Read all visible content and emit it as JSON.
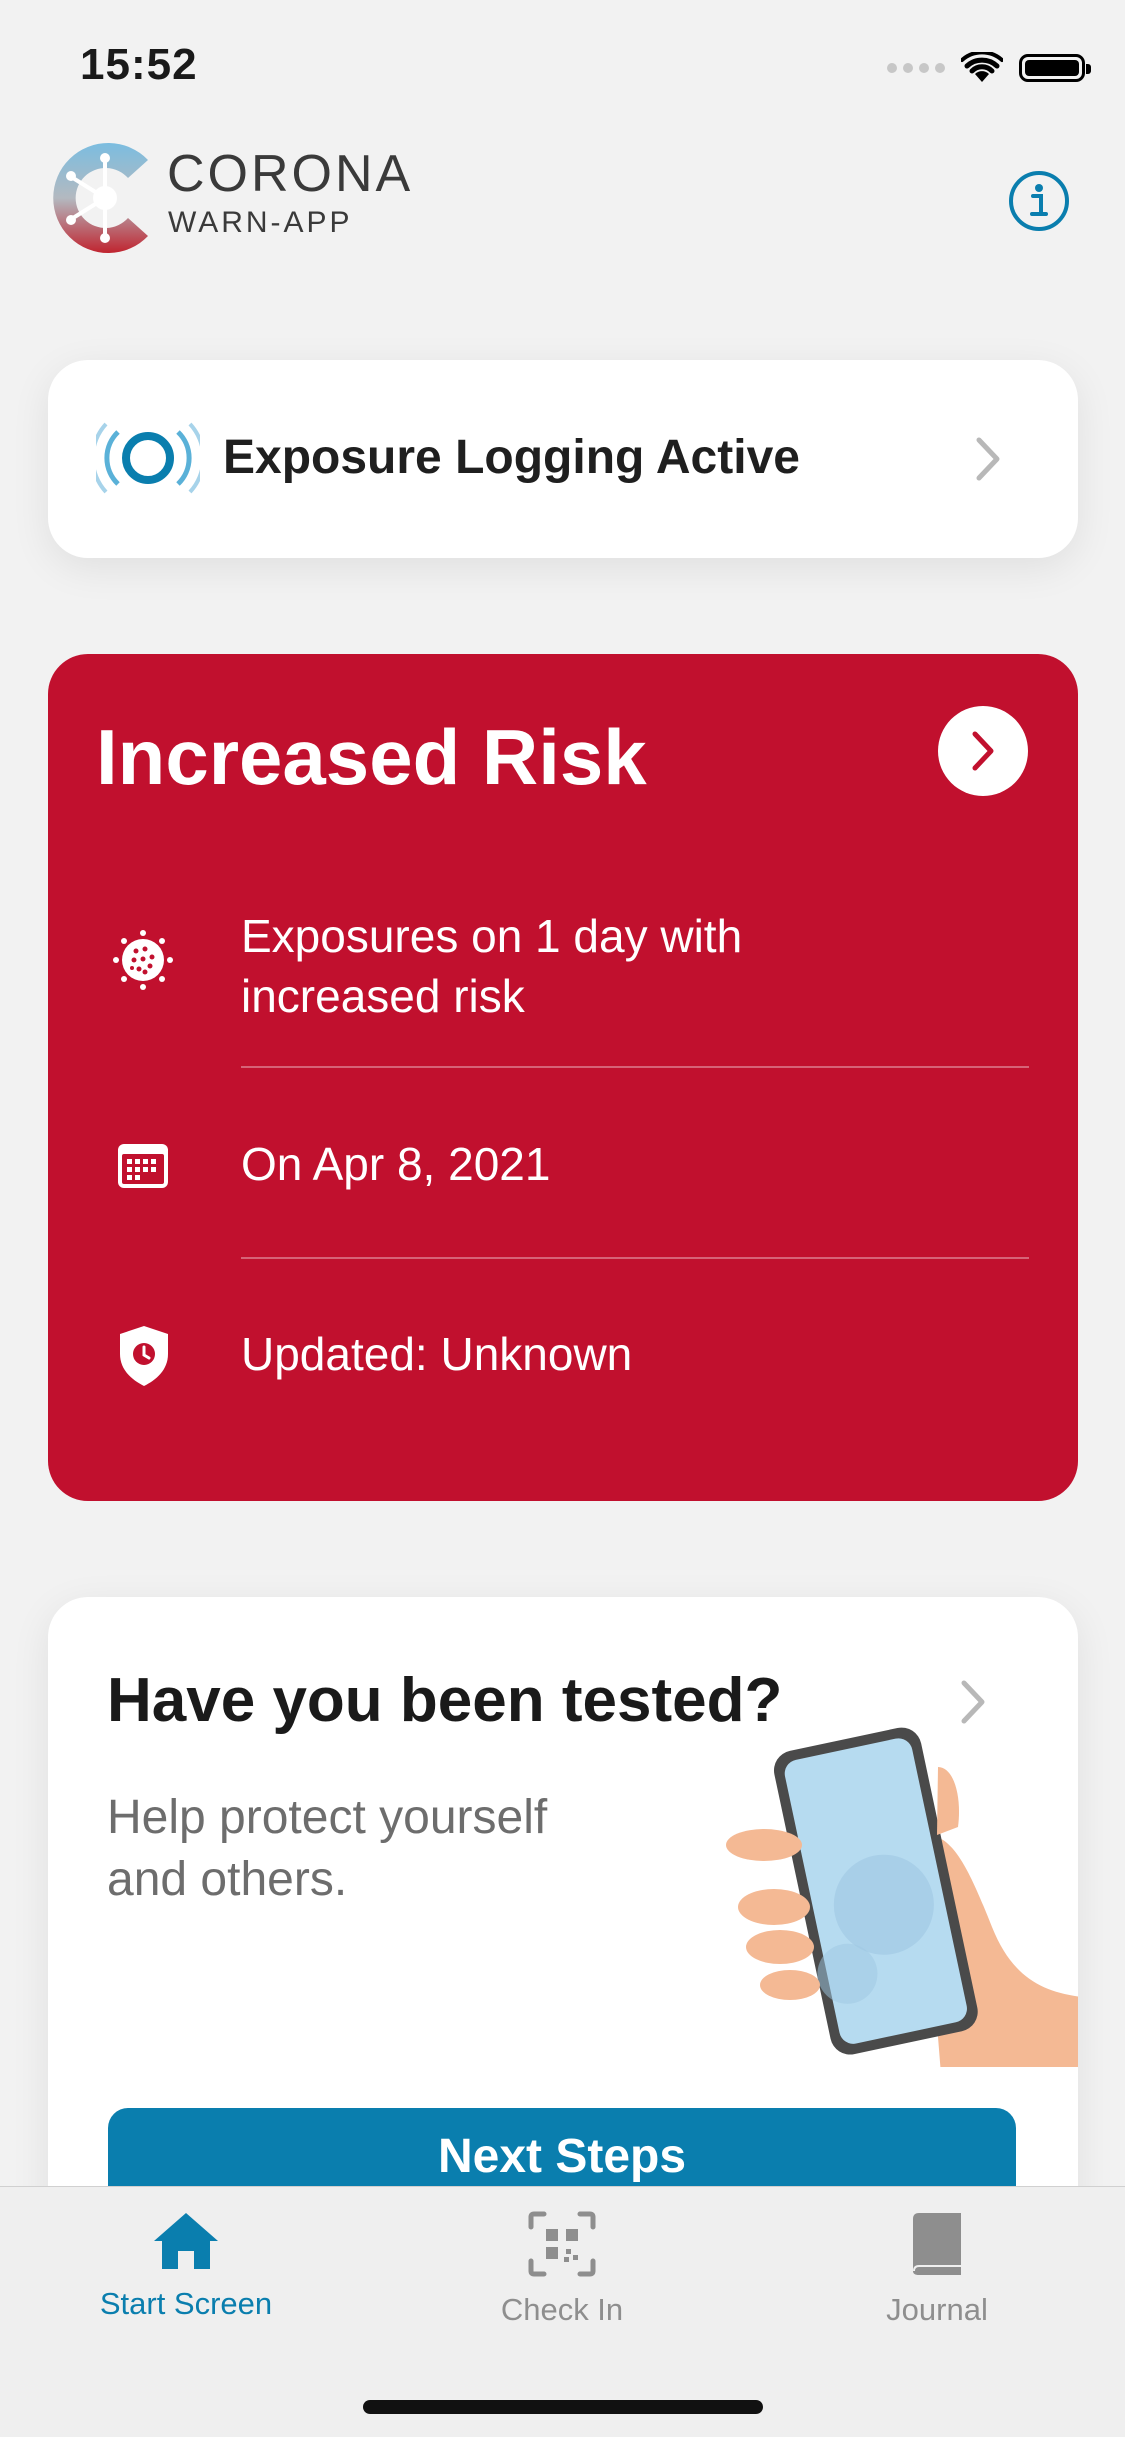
{
  "status_bar": {
    "time": "15:52"
  },
  "header": {
    "app_title": "CORONA",
    "app_subtitle": "WARN-APP"
  },
  "exposure_logging": {
    "label": "Exposure Logging Active"
  },
  "risk_card": {
    "title": "Increased Risk",
    "background_color": "#c1102e",
    "rows": [
      {
        "icon": "virus-icon",
        "text_line1": "Exposures on 1 day with",
        "text_line2": "increased risk"
      },
      {
        "icon": "calendar-icon",
        "text": "On Apr 8, 2021"
      },
      {
        "icon": "shield-clock-icon",
        "text": "Updated: Unknown"
      }
    ]
  },
  "tested_card": {
    "title": "Have you been tested?",
    "body_line1": "Help protect yourself",
    "body_line2": "and others.",
    "button_label": "Next Steps"
  },
  "tab_bar": {
    "active_color": "#0a7eae",
    "inactive_color": "#8e8e8e",
    "tabs": [
      {
        "label": "Start Screen",
        "icon": "home-icon",
        "active": true
      },
      {
        "label": "Check In",
        "icon": "qr-code-icon",
        "active": false
      },
      {
        "label": "Journal",
        "icon": "book-icon",
        "active": false
      }
    ]
  }
}
